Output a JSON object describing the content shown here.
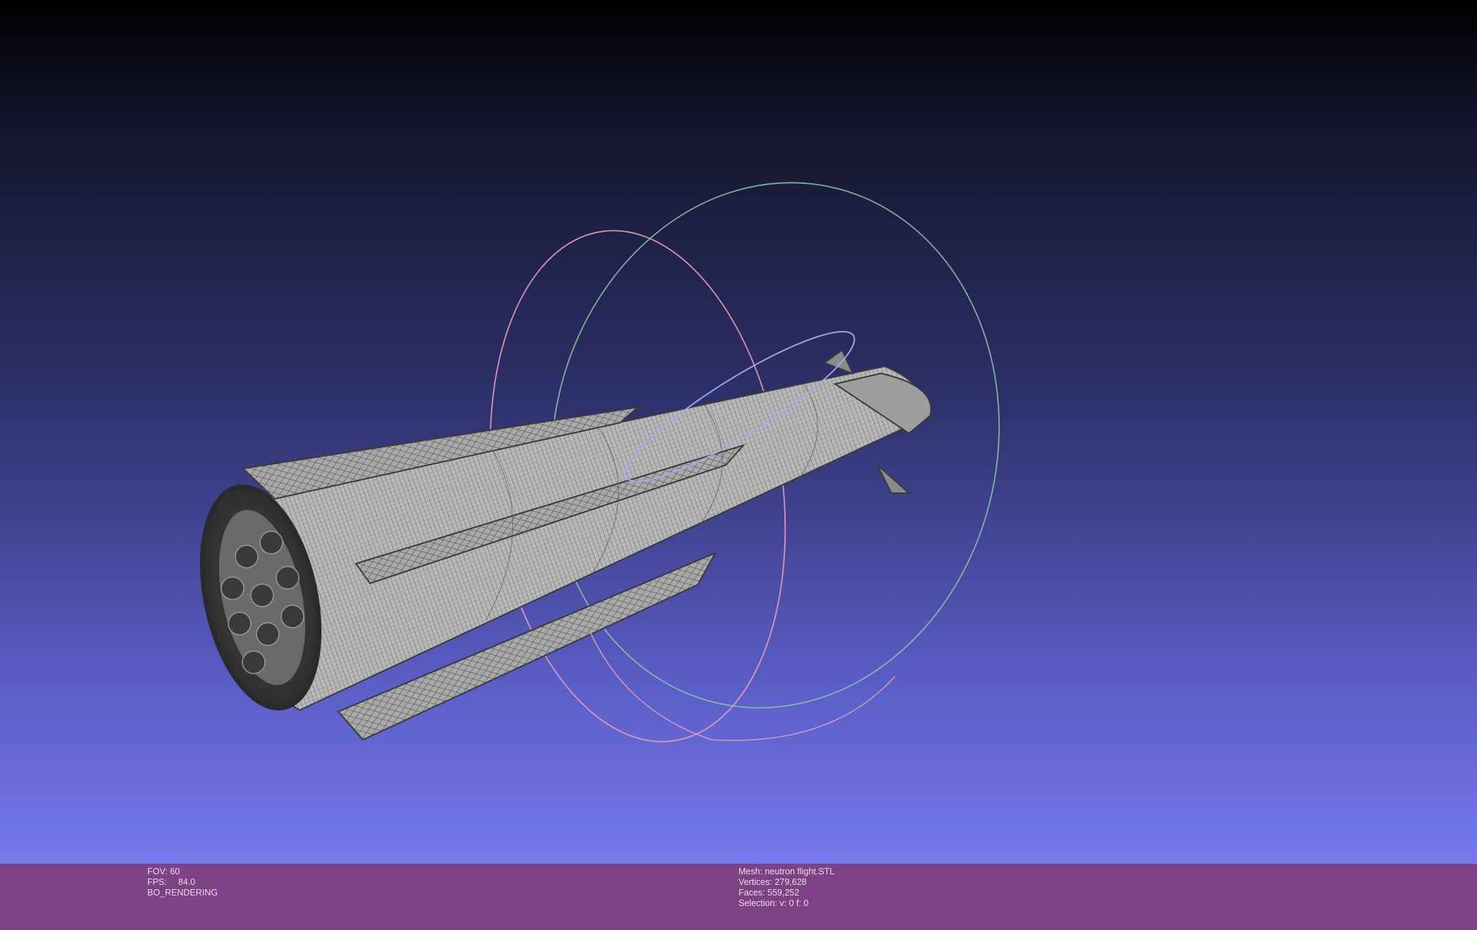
{
  "viewport": {
    "trackball": {
      "ring_x_color": "#e8a0b8",
      "ring_y_color": "#9ee6b0",
      "ring_z_color": "#a9a8f0"
    },
    "model_icon": "wireframe-rocket-mesh"
  },
  "info_left": {
    "fov_label": "FOV:",
    "fov_value": "60",
    "fps_label": "FPS:",
    "fps_value": "84.0",
    "render_mode": "BO_RENDERING"
  },
  "info_right": {
    "mesh_label": "Mesh:",
    "mesh_value": "neutron flight.STL",
    "vertices_label": "Vertices:",
    "vertices_value": "279,628",
    "faces_label": "Faces:",
    "faces_value": "559,252",
    "selection_label": "Selection:",
    "selection_value": "v: 0 f: 0"
  },
  "colors": {
    "info_bar_bg": "#7d4284",
    "gradient_top": "#000000",
    "gradient_bottom": "#7679ea"
  }
}
